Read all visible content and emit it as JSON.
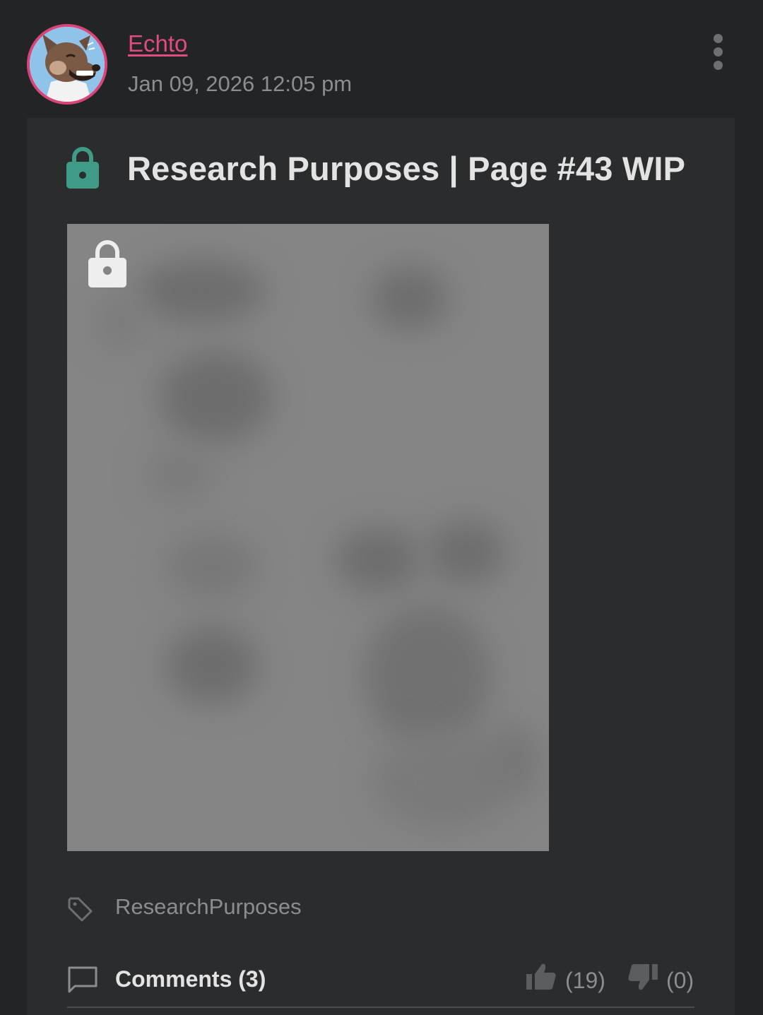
{
  "post": {
    "author": "Echto",
    "timestamp": "Jan 09, 2026 12:05 pm",
    "title": "Research Purposes | Page #43 WIP",
    "locked": true,
    "tag": "ResearchPurposes",
    "comments_label": "Comments (3)",
    "likes": "(19)",
    "dislikes": "(0)"
  },
  "colors": {
    "background": "#232425",
    "card": "#2b2c2d",
    "author_accent": "#e14b84",
    "lock_teal": "#3f9a86",
    "muted_text": "#8c8d8e"
  },
  "icons": {
    "menu": "more-vertical-icon",
    "title_lock": "lock-icon",
    "preview_lock": "lock-icon",
    "tag": "tag-icon",
    "comments": "comment-icon",
    "like": "thumbs-up-icon",
    "dislike": "thumbs-down-icon"
  }
}
